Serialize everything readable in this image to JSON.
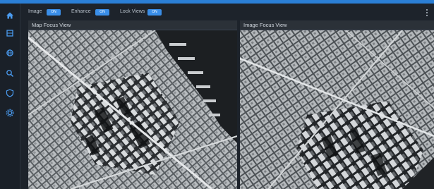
{
  "toolbar": {
    "image_label": "Image",
    "image_toggle": "ON",
    "enhance_label": "Enhance",
    "enhance_toggle": "ON",
    "lock_views_label": "Lock Views",
    "lock_views_toggle": "ON"
  },
  "sidebar": {
    "items": [
      {
        "icon": "home-icon"
      },
      {
        "icon": "layers-icon"
      },
      {
        "icon": "globe-icon"
      },
      {
        "icon": "search-icon"
      },
      {
        "icon": "shield-icon"
      },
      {
        "icon": "gear-icon"
      }
    ]
  },
  "panels": {
    "map_focus_title": "Map Focus View",
    "image_focus_title": "Image Focus View"
  },
  "colors": {
    "accent": "#2b7fd6",
    "toggle_on": "#3a8ee8",
    "background": "#1d232b",
    "panel_header": "#2b3138"
  }
}
